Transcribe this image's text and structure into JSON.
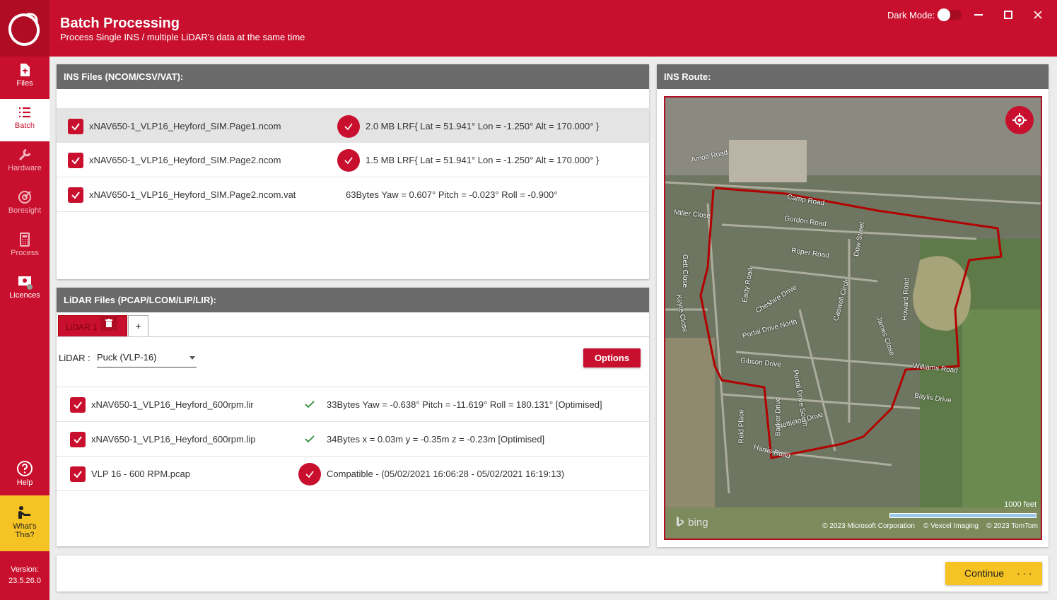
{
  "app": {
    "title": "Batch Processing",
    "subtitle": "Process Single INS / multiple LiDAR's data at the same time",
    "dark_mode_label": "Dark Mode:",
    "dark_mode_on": false,
    "accent_color": "#c8102e"
  },
  "sidebar": {
    "items": [
      {
        "label": "Files",
        "icon": "file-icon"
      },
      {
        "label": "Batch",
        "icon": "list-icon",
        "active": true
      },
      {
        "label": "Hardware",
        "icon": "wrench-icon"
      },
      {
        "label": "Boresight",
        "icon": "target-icon"
      },
      {
        "label": "Process",
        "icon": "calculator-icon"
      },
      {
        "label": "Licences",
        "icon": "licence-icon"
      }
    ],
    "help_label": "Help",
    "whats_this_line1": "What's",
    "whats_this_line2": "This?",
    "version_label": "Version:",
    "version_value": "23.5.26.0"
  },
  "ins_panel": {
    "title": "INS Files (NCOM/CSV/VAT):",
    "files": [
      {
        "name": "xNAV650-1_VLP16_Heyford_SIM.Page1.ncom",
        "info": "2.0 MB  LRF{ Lat = 51.941°  Lon = -1.250°  Alt = 170.000° }",
        "status": "circle"
      },
      {
        "name": "xNAV650-1_VLP16_Heyford_SIM.Page2.ncom",
        "info": "1.5 MB  LRF{ Lat = 51.941°  Lon = -1.250°  Alt = 170.000° }",
        "status": "circle"
      },
      {
        "name": "xNAV650-1_VLP16_Heyford_SIM.Page2.ncom.vat",
        "info": "63Bytes Yaw = 0.607°  Pitch = -0.023°  Roll = -0.900°",
        "status": "none"
      }
    ]
  },
  "lidar_panel": {
    "title": "LiDAR Files (PCAP/LCOM/LIP/LIR):",
    "tab_label": "LiDAR 1",
    "add_tab_label": "+",
    "lidar_label": "LiDAR :",
    "lidar_value": "Puck (VLP-16)",
    "options_label": "Options",
    "files": [
      {
        "name": "xNAV650-1_VLP16_Heyford_600rpm.lir",
        "info": "33Bytes  Yaw = -0.638°  Pitch = -11.619°  Roll = 180.131° [Optimised]",
        "status": "tick"
      },
      {
        "name": "xNAV650-1_VLP16_Heyford_600rpm.lip",
        "info": "34Bytes  x = 0.03m y = -0.35m  z = -0.23m [Optimised]",
        "status": "tick"
      },
      {
        "name": "VLP 16 - 600 RPM.pcap",
        "info": "Compatible - (05/02/2021 16:06:28 - 05/02/2021 16:19:13)",
        "status": "circle"
      }
    ]
  },
  "route_panel": {
    "title": "INS Route:",
    "streets": [
      "Amott Road",
      "Camp Road",
      "Gordon Road",
      "Miller Close",
      "Roper Road",
      "Dow Street",
      "Gett Close",
      "Eady Road",
      "Cheshire Drive",
      "Caswell Circle",
      "Howard Road",
      "Keyte Close",
      "Portal Drive North",
      "James Close",
      "Gibson Drive",
      "Portal Drive South",
      "Baylis Drive",
      "Williams Road",
      "Nettleton Drive",
      "Reid Place",
      "Harris Road",
      "Barker Drive"
    ],
    "scale_label": "1000 feet",
    "bing_label": "bing",
    "copyrights": [
      "© 2023 Microsoft Corporation",
      "© Vexcel Imaging",
      "© 2023 TomTom"
    ]
  },
  "footer": {
    "continue_label": "Continue",
    "continue_dots": "· · ·"
  }
}
